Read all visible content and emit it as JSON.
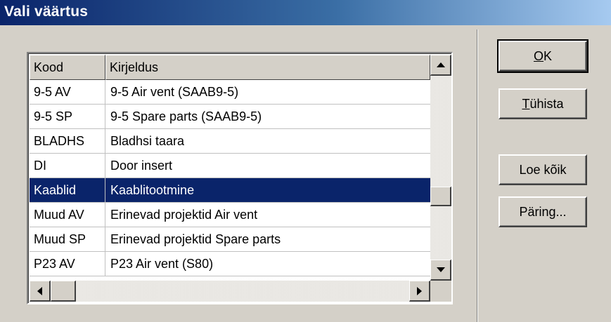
{
  "window": {
    "title": "Vali väärtus"
  },
  "list": {
    "columns": [
      "Kood",
      "Kirjeldus"
    ],
    "rows": [
      {
        "kood": "9-5 AV",
        "kirjeldus": "9-5 Air vent (SAAB9-5)"
      },
      {
        "kood": "9-5 SP",
        "kirjeldus": "9-5 Spare parts (SAAB9-5)"
      },
      {
        "kood": "BLADHS",
        "kirjeldus": "Bladhsi taara"
      },
      {
        "kood": "DI",
        "kirjeldus": "Door insert"
      },
      {
        "kood": "Kaablid",
        "kirjeldus": "Kaablitootmine"
      },
      {
        "kood": "Muud AV",
        "kirjeldus": "Erinevad projektid Air vent"
      },
      {
        "kood": "Muud SP",
        "kirjeldus": "Erinevad projektid Spare parts"
      },
      {
        "kood": "P23 AV",
        "kirjeldus": "P23 Air vent (S80)"
      }
    ],
    "selected_index": 4
  },
  "buttons": {
    "ok": {
      "mnemonic": "O",
      "rest": "K"
    },
    "cancel": {
      "mnemonic": "T",
      "rest": "ühista"
    },
    "load_all": {
      "label": "Loe kõik"
    },
    "query": {
      "label": "Päring..."
    }
  },
  "icons": [
    "scroll-up-icon",
    "scroll-down-icon",
    "scroll-left-icon",
    "scroll-right-icon"
  ],
  "colors": {
    "selection": "#0a246a",
    "title_start": "#0a246a",
    "title_end": "#a6caf0"
  }
}
